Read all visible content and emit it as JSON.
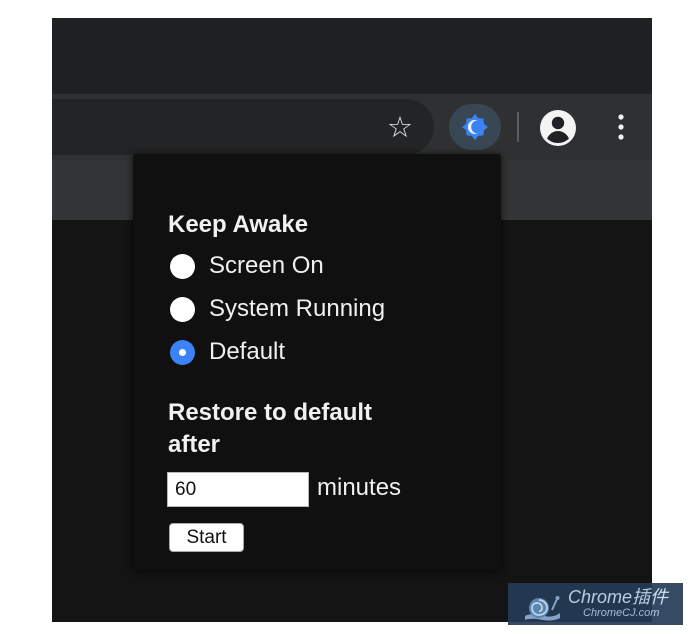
{
  "browser_toolbar": {
    "icons": {
      "star": "star-icon",
      "extension": "keep-awake-extension-icon",
      "profile": "account-icon",
      "menu": "vertical-dots-menu-icon"
    },
    "extension_color": "#3b82f6"
  },
  "popup": {
    "title": "Keep Awake",
    "options": [
      {
        "label": "Screen On",
        "selected": false
      },
      {
        "label": "System Running",
        "selected": false
      },
      {
        "label": "Default",
        "selected": true
      }
    ],
    "restore_label": "Restore to default after",
    "minutes_value": "60",
    "minutes_label": "minutes",
    "start_label": "Start"
  },
  "watermark": {
    "title": "Chrome插件",
    "subtitle": "ChromeCJ.com"
  }
}
